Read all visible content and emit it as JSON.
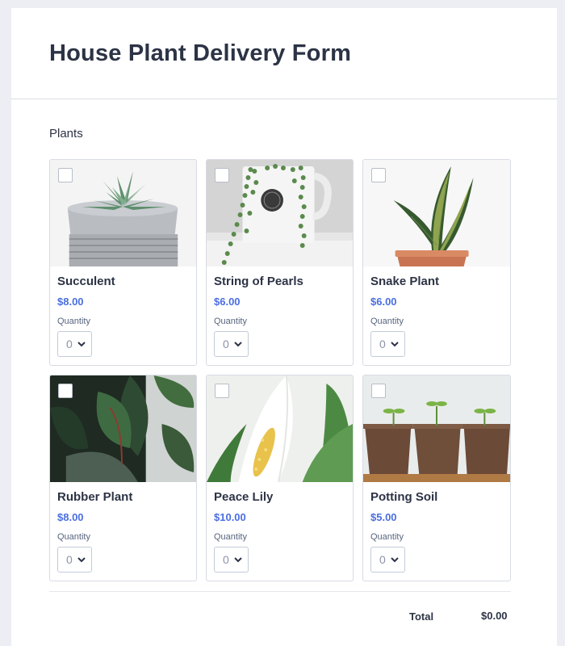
{
  "form": {
    "title": "House Plant Delivery Form",
    "section_label": "Plants",
    "quantity_label": "Quantity",
    "total_label": "Total",
    "total_value": "$0.00",
    "accent_color": "#4a6ee0"
  },
  "products": [
    {
      "name": "Succulent",
      "price": "$8.00",
      "quantity": "0",
      "image": "succulent-in-gray-pot"
    },
    {
      "name": "String of Pearls",
      "price": "$6.00",
      "quantity": "0",
      "image": "string-of-pearls-in-white-mug"
    },
    {
      "name": "Snake Plant",
      "price": "$6.00",
      "quantity": "0",
      "image": "snake-plant-in-terracotta-pot"
    },
    {
      "name": "Rubber Plant",
      "price": "$8.00",
      "quantity": "0",
      "image": "rubber-plant-leaves"
    },
    {
      "name": "Peace Lily",
      "price": "$10.00",
      "quantity": "0",
      "image": "peace-lily-flower"
    },
    {
      "name": "Potting Soil",
      "price": "$5.00",
      "quantity": "0",
      "image": "seedlings-in-peat-pots"
    }
  ]
}
